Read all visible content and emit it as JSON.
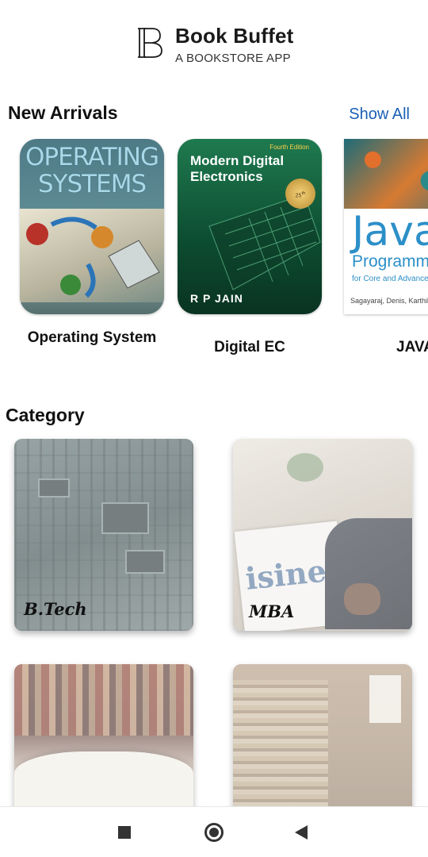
{
  "header": {
    "title": "Book Buffet",
    "subtitle": "A BOOKSTORE APP",
    "logo_icon": "book-logo-icon"
  },
  "new_arrivals": {
    "title": "New Arrivals",
    "show_all_label": "Show All",
    "books": [
      {
        "label": "Operating System",
        "cover": {
          "title": "OPERATING SYSTEMS"
        }
      },
      {
        "label": "Digital EC",
        "cover": {
          "title": "Modern Digital Electronics",
          "edition": "Fourth Edition",
          "badge": "25th Anniversary Edition",
          "author": "R P JAIN"
        }
      },
      {
        "label": "JAVA",
        "cover": {
          "title": "Java",
          "subtitle": "Programm",
          "small": "for Core and Advanced",
          "authors": "Sagayaraj, Denis, Karthik an"
        }
      }
    ]
  },
  "category": {
    "title": "Category",
    "cards": [
      {
        "label": "B.Tech"
      },
      {
        "label": "MBA",
        "paper_text": "isiness"
      },
      {
        "label": ""
      },
      {
        "label": ""
      }
    ]
  },
  "navbar": {
    "recents_icon": "square-icon",
    "home_icon": "circle-home-icon",
    "back_icon": "triangle-back-icon"
  }
}
